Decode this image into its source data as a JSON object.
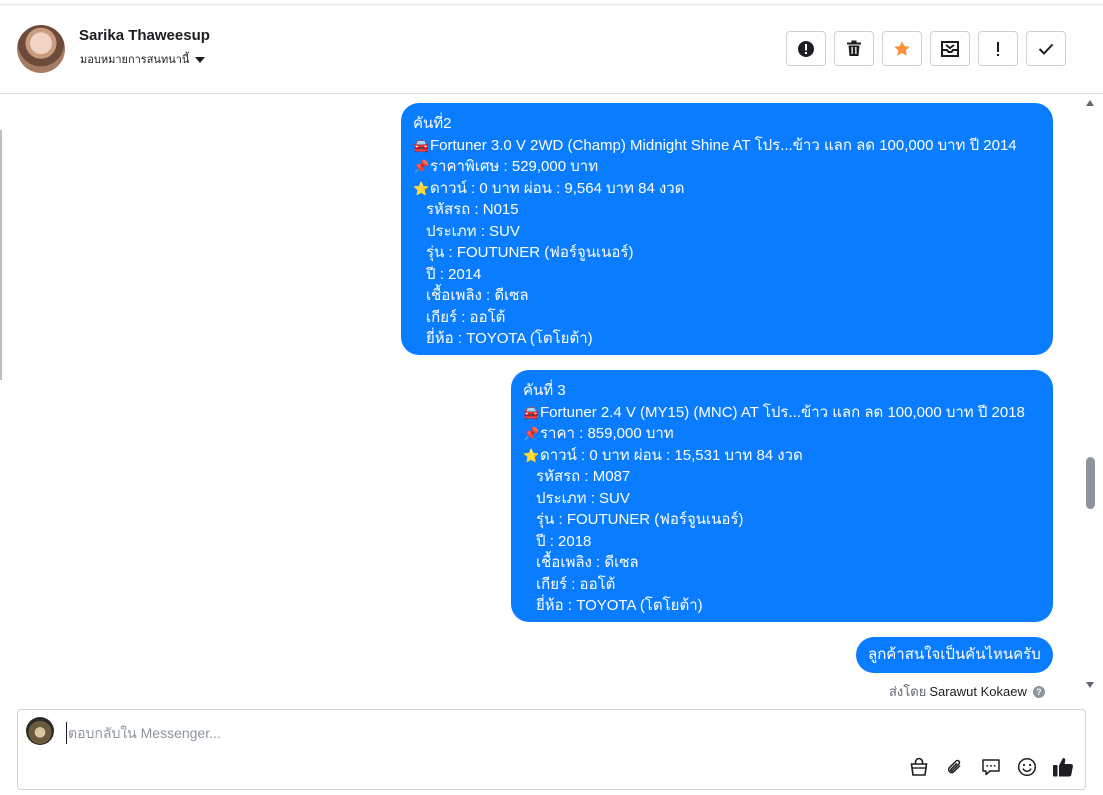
{
  "header": {
    "contact_name": "Sarika Thaweesup",
    "assign_label": "มอบหมายการสนทนานี้",
    "toolbar": [
      {
        "name": "spam-button",
        "icon": "alert-circle-icon"
      },
      {
        "name": "delete-button",
        "icon": "trash-icon"
      },
      {
        "name": "star-button",
        "icon": "star-icon",
        "color": "#f7923a"
      },
      {
        "name": "archive-button",
        "icon": "inbox-archive-icon"
      },
      {
        "name": "follow-up-button",
        "icon": "exclamation-icon"
      },
      {
        "name": "done-button",
        "icon": "check-icon"
      }
    ]
  },
  "messages": [
    {
      "title": "คันที่2",
      "car_line": "Fortuner 3.0 V 2WD (Champ) Midnight Shine AT โปร...ข้าว แลก ลด 100,000 บาท ปี 2014",
      "price_line": "ราคาพิเศษ : 529,000 บาท",
      "down_line": "ดาวน์ : 0 บาท ผ่อน : 9,564 บาท 84 งวด",
      "details": [
        "รหัสรถ : N015",
        "ประเภท : SUV",
        "รุ่น : FOUTUNER (ฟอร์จูนเนอร์)",
        "ปี : 2014",
        "เชื้อเพลิง : ดีเซล",
        "เกียร์ : ออโต้",
        "ยี่ห้อ : TOYOTA (โตโยต้า)"
      ]
    },
    {
      "title": "คันที่ 3",
      "car_line": "Fortuner 2.4 V (MY15) (MNC) AT โปร...ข้าว แลก ลด 100,000 บาท ปี 2018",
      "price_line": "ราคา : 859,000 บาท",
      "down_line": "ดาวน์ : 0 บาท ผ่อน : 15,531 บาท 84 งวด",
      "details": [
        "รหัสรถ : M087",
        "ประเภท : SUV",
        "รุ่น : FOUTUNER (ฟอร์จูนเนอร์)",
        "ปี : 2018",
        "เชื้อเพลิง : ดีเซล",
        "เกียร์ : ออโต้",
        "ยี่ห้อ : TOYOTA (โตโยต้า)"
      ]
    },
    {
      "text": "ลูกค้าสนใจเป็นคันไหนครับ"
    }
  ],
  "emoji": {
    "car": "🚘",
    "pin": "📌",
    "star": "⭐"
  },
  "sent_by": {
    "label": "ส่งโดย",
    "name": "Sarawut Kokaew",
    "help": "?"
  },
  "composer": {
    "placeholder": "ตอบกลับใน Messenger...",
    "value": "",
    "icons": [
      "shopping-bag-icon",
      "paperclip-icon",
      "saved-reply-icon",
      "emoji-icon",
      "thumbs-up-icon"
    ]
  },
  "colors": {
    "accent": "#0a7cff",
    "star": "#f7923a"
  }
}
